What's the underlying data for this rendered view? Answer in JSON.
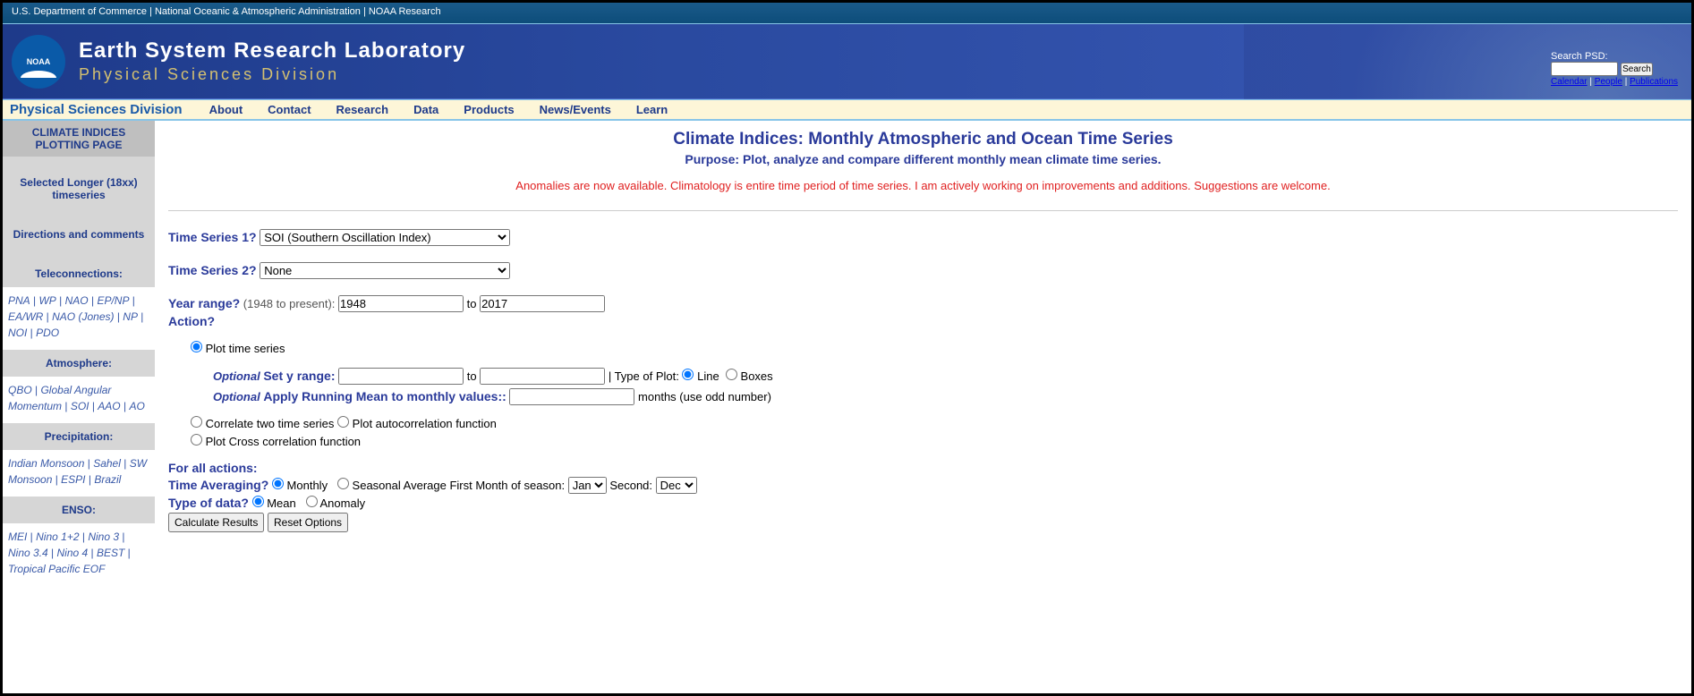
{
  "topbar": {
    "links": [
      "U.S. Department of Commerce",
      "National Oceanic & Atmospheric Administration",
      "NOAA Research"
    ]
  },
  "banner": {
    "logo_text": "NOAA",
    "title": "Earth System Research Laboratory",
    "subtitle": "Physical Sciences Division",
    "search_label": "Search PSD:",
    "search_btn": "Search",
    "quick_links": [
      "Calendar",
      "People",
      "Publications"
    ]
  },
  "nav": {
    "psd": "Physical Sciences Division",
    "items": [
      "About",
      "Contact",
      "Research",
      "Data",
      "Products",
      "News/Events",
      "Learn"
    ]
  },
  "sidebar": {
    "title": "CLIMATE INDICES PLOTTING PAGE",
    "groups": [
      {
        "head": "Selected Longer (18xx) timeseries",
        "links": []
      },
      {
        "head": "Directions and comments",
        "links": []
      },
      {
        "head": "Teleconnections:",
        "links": [
          "PNA",
          "WP",
          "NAO",
          "EP/NP",
          "EA/WR",
          "NAO (Jones)",
          "NP",
          "NOI",
          "PDO"
        ]
      },
      {
        "head": "Atmosphere:",
        "links": [
          "QBO",
          "Global Angular Momentum",
          "SOI",
          "AAO",
          "AO"
        ]
      },
      {
        "head": "Precipitation:",
        "links": [
          "Indian Monsoon",
          "Sahel",
          "SW Monsoon",
          "ESPI",
          "Brazil"
        ]
      },
      {
        "head": "ENSO:",
        "links": [
          "MEI",
          "Nino 1+2",
          "Nino 3",
          "Nino 3.4",
          "Nino 4",
          "BEST",
          "Tropical Pacific EOF"
        ]
      }
    ]
  },
  "main": {
    "title": "Climate Indices: Monthly Atmospheric and Ocean Time Series",
    "purpose": "Purpose: Plot, analyze and compare different monthly mean climate time series.",
    "alert": "Anomalies are now available. Climatology is entire time period of time series. I am actively working on improvements and additions. Suggestions are welcome.",
    "ts1_label": "Time Series 1?",
    "ts1_value": "SOI (Southern Oscillation Index)",
    "ts2_label": "Time Series 2?",
    "ts2_value": "None",
    "year_label": "Year range?",
    "year_note": "(1948 to present):",
    "year_from": "1948",
    "year_to_text": "to",
    "year_to": "2017",
    "action_label": "Action?",
    "actions": {
      "plot": "Plot time series",
      "correlate": "Correlate two time series",
      "autocorr": "Plot autocorrelation function",
      "crosscorr": "Plot Cross correlation function"
    },
    "optional": "Optional",
    "yrange": "Set y range:",
    "type_of_plot": "| Type of Plot:",
    "plot_line": "Line",
    "plot_boxes": "Boxes",
    "running_mean": "Apply Running Mean to monthly values::",
    "months_note": "months (use odd number)",
    "for_all": "For all actions:",
    "time_avg_label": "Time Averaging?",
    "monthly": "Monthly",
    "seasonal": "Seasonal Average First Month of season:",
    "second": "Second:",
    "jan": "Jan",
    "dec": "Dec",
    "type_data_label": "Type of data?",
    "mean": "Mean",
    "anomaly": "Anomaly",
    "calc_btn": "Calculate Results",
    "reset_btn": "Reset Options"
  }
}
